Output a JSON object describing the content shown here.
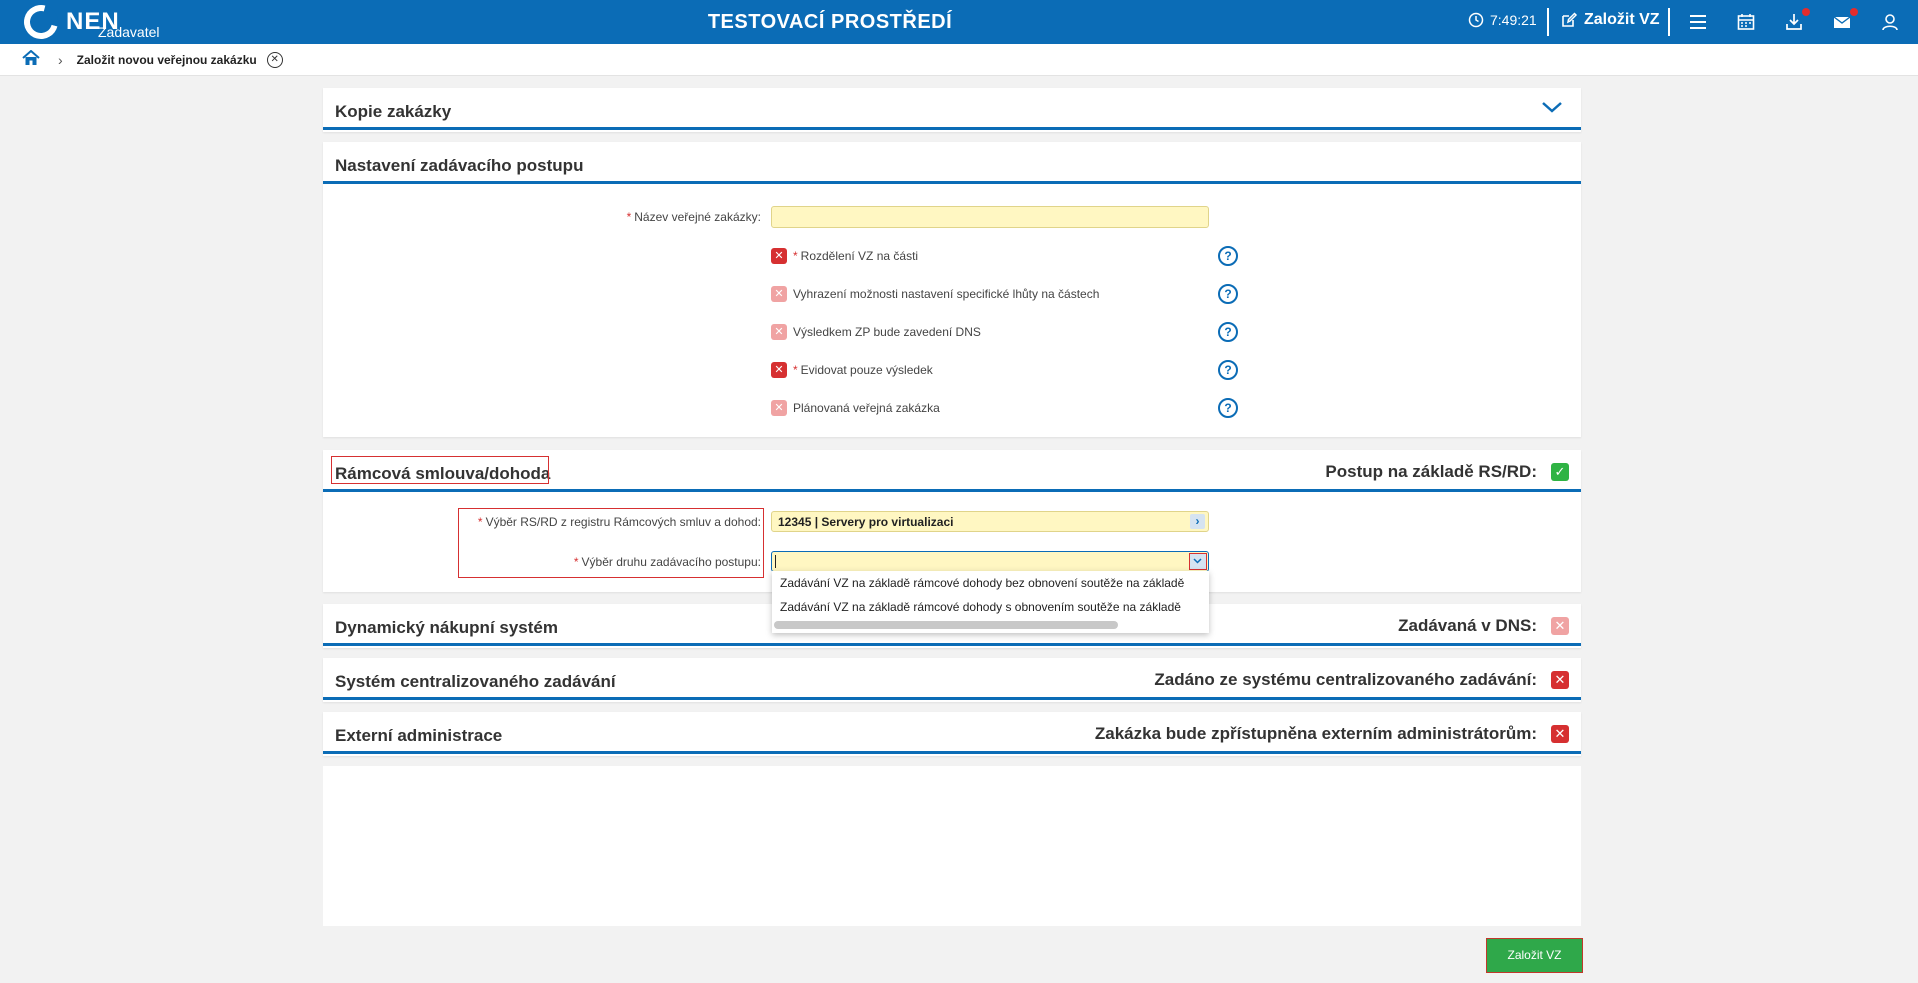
{
  "header": {
    "logo_text": "NEN",
    "logo_sub": "Zadavatel",
    "env_title": "TESTOVACÍ PROSTŘEDÍ",
    "time": "7:49:21",
    "new_vz_label": "Založit VZ"
  },
  "breadcrumb": {
    "current": "Založit novou veřejnou zakázku"
  },
  "sections": {
    "copy": {
      "title": "Kopie zakázky"
    },
    "setup": {
      "title": "Nastavení zadávacího postupu",
      "name_label": "Název veřejné zakázky:",
      "name_value": "",
      "options": [
        {
          "label": "Rozdělení VZ na části",
          "required": true,
          "state": "red"
        },
        {
          "label": "Vyhrazení možnosti nastavení specifické lhůty na částech",
          "required": false,
          "state": "pink"
        },
        {
          "label": "Výsledkem ZP bude zavedení DNS",
          "required": false,
          "state": "pink"
        },
        {
          "label": "Evidovat pouze výsledek",
          "required": true,
          "state": "red"
        },
        {
          "label": "Plánovaná veřejná zakázka",
          "required": false,
          "state": "pink"
        }
      ]
    },
    "framework": {
      "title": "Rámcová smlouva/dohoda",
      "right_label": "Postup na základě RS/RD:",
      "registry_label": "Výběr RS/RD z registru Rámcových smluv a dohod:",
      "registry_value": "12345 | Servery pro virtualizaci",
      "procedure_label": "Výběr druhu zadávacího postupu:",
      "procedure_value": "",
      "dropdown_options": [
        "Zadávání VZ na základě rámcové dohody bez obnovení soutěže na základě",
        "Zadávání VZ na základě rámcové dohody s obnovením soutěže na základě"
      ]
    },
    "dns": {
      "title": "Dynamický nákupní systém",
      "right_label": "Zadávaná v DNS:"
    },
    "central": {
      "title": "Systém centralizovaného zadávání",
      "right_label": "Zadáno ze systému centralizovaného zadávání:"
    },
    "external": {
      "title": "Externí administrace",
      "right_label": "Zakázka bude zpřístupněna externím administrátorům:"
    }
  },
  "footer": {
    "submit_label": "Založit VZ"
  },
  "colors": {
    "primary": "#0b6cb6",
    "required": "#d63031",
    "success": "#2fb344",
    "input_bg": "#fff7c2"
  }
}
